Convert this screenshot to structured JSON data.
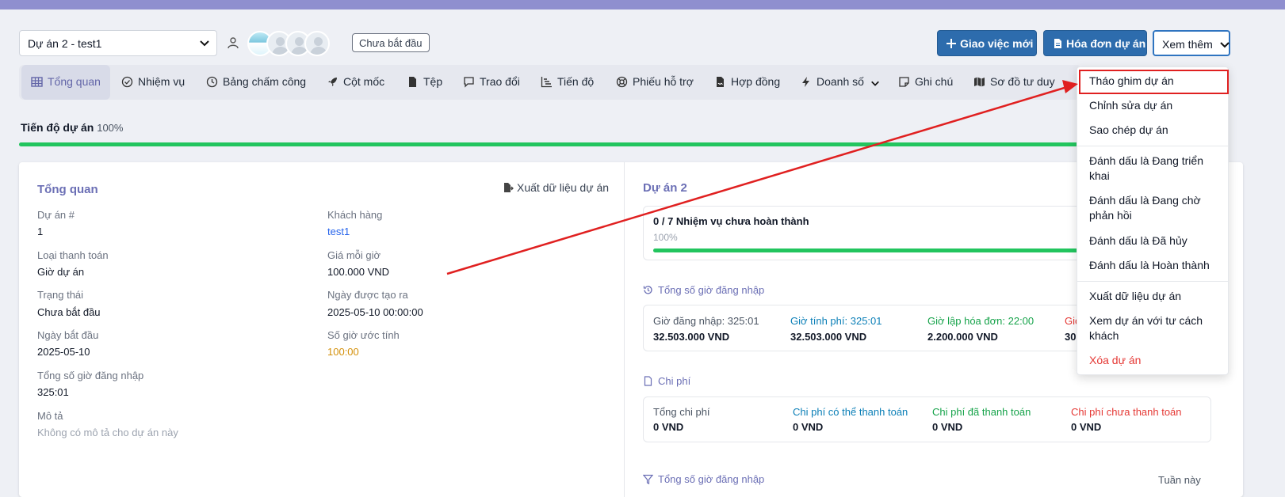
{
  "header": {
    "project_select_value": "Dự án 2 - test1",
    "status_badge": "Chưa bắt đầu",
    "new_task_label": "Giao việc mới",
    "invoice_label": "Hóa đơn dự án",
    "more_label": "Xem thêm"
  },
  "nav": {
    "items": [
      {
        "label": "Tổng quan",
        "icon": "grid-icon"
      },
      {
        "label": "Nhiệm vụ",
        "icon": "check-circle-icon"
      },
      {
        "label": "Bảng chấm công",
        "icon": "clock-icon"
      },
      {
        "label": "Cột mốc",
        "icon": "rocket-icon"
      },
      {
        "label": "Tệp",
        "icon": "file-icon"
      },
      {
        "label": "Trao đổi",
        "icon": "chat-icon"
      },
      {
        "label": "Tiến độ",
        "icon": "chart-icon"
      },
      {
        "label": "Phiếu hỗ trợ",
        "icon": "lifebuoy-icon"
      },
      {
        "label": "Hợp đồng",
        "icon": "contract-icon"
      },
      {
        "label": "Doanh số",
        "icon": "bolt-icon"
      },
      {
        "label": "Ghi chú",
        "icon": "note-icon"
      },
      {
        "label": "Sơ đồ tư duy",
        "icon": "map-icon"
      }
    ]
  },
  "progress": {
    "label": "Tiến độ dự án",
    "value_text": "100%",
    "value": 1.0
  },
  "overview": {
    "title": "Tổng quan",
    "export_label": "Xuất dữ liệu dự án",
    "fields": {
      "project_no_label": "Dự án #",
      "project_no": "1",
      "customer_label": "Khách hàng",
      "customer": "test1",
      "billing_type_label": "Loại thanh toán",
      "billing_type": "Giờ dự án",
      "rate_label": "Giá mỗi giờ",
      "rate": "100.000 VND",
      "status_label": "Trạng thái",
      "status": "Chưa bắt đầu",
      "created_label": "Ngày được tạo ra",
      "created": "2025-05-10 00:00:00",
      "start_label": "Ngày bắt đầu",
      "start": "2025-05-10",
      "estimate_label": "Số giờ ước tính",
      "estimate": "100:00",
      "logged_label": "Tổng số giờ đăng nhập",
      "logged": "325:01",
      "desc_label": "Mô tả",
      "desc": "Không có mô tả cho dự án này"
    }
  },
  "right": {
    "title": "Dự án 2",
    "tasks_text": "0 / 7 Nhiệm vụ chưa hoàn thành",
    "tasks_pct": "100%",
    "tasks_value": 1.0,
    "hours_title": "Tổng số giờ đăng nhập",
    "hours": {
      "logged_label": "Giờ đăng nhập: 325:01",
      "logged_value": "32.503.000 VND",
      "billable_label": "Giờ tính phí: 325:01",
      "billable_value": "32.503.000 VND",
      "invoiced_label": "Giờ lập hóa đơn: 22:00",
      "invoiced_value": "2.200.000 VND",
      "unbilled_label": "Giờ",
      "unbilled_value": "30"
    },
    "expenses_title": "Chi phí",
    "expenses": {
      "total_label": "Tổng chi phí",
      "total_value": "0 VND",
      "billable_label": "Chi phí có thể thanh toán",
      "billable_value": "0 VND",
      "paid_label": "Chi phí đã thanh toán",
      "paid_value": "0 VND",
      "unpaid_label": "Chi phí chưa thanh toán",
      "unpaid_value": "0 VND"
    },
    "bottom_title": "Tổng số giờ đăng nhập",
    "bottom_filter": "Tuần này"
  },
  "dropdown": {
    "items": [
      "Tháo ghim dự án",
      "Chỉnh sửa dự án",
      "Sao chép dự án",
      "Đánh dấu là Đang triển khai",
      "Đánh dấu là Đang chờ phản hồi",
      "Đánh dấu là Đã hủy",
      "Đánh dấu là Hoàn thành",
      "Xuất dữ liệu dự án",
      "Xem dự án với tư cách khách",
      "Xóa dự án"
    ]
  },
  "colors": {
    "accent": "#6b6fb5",
    "primary": "#2d6cad",
    "success": "#22c55e",
    "danger": "#e53935",
    "annotation": "#e02020"
  }
}
